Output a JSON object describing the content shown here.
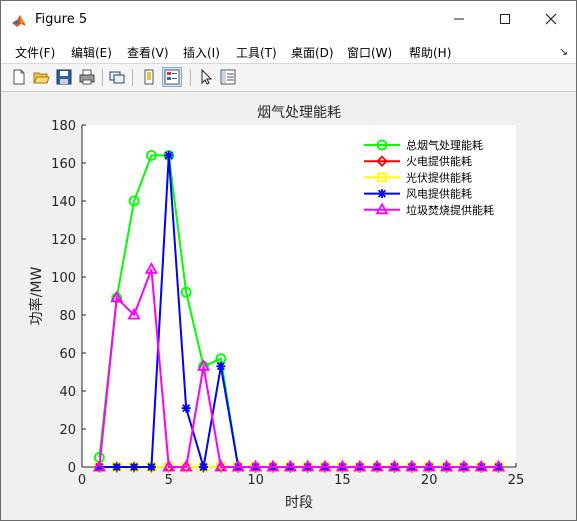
{
  "window": {
    "title": "Figure 5"
  },
  "menu": [
    "文件(F)",
    "编辑(E)",
    "查看(V)",
    "插入(I)",
    "工具(T)",
    "桌面(D)",
    "窗口(W)",
    "帮助(H)"
  ],
  "toolbar_icons": [
    "new-figure-icon",
    "open-file-icon",
    "save-icon",
    "print-icon",
    "link-plot-icon",
    "hide-plot-tools-icon",
    "show-plot-tools-icon",
    "edit-plot-icon",
    "property-inspector-icon"
  ],
  "chart_data": {
    "type": "line",
    "title": "烟气处理能耗",
    "xlabel": "时段",
    "ylabel": "功率/MW",
    "xlim": [
      0,
      25
    ],
    "ylim": [
      0,
      180
    ],
    "xticks": [
      0,
      5,
      10,
      15,
      20,
      25
    ],
    "yticks": [
      0,
      20,
      40,
      60,
      80,
      100,
      120,
      140,
      160,
      180
    ],
    "x": [
      1,
      2,
      3,
      4,
      5,
      6,
      7,
      8,
      9,
      10,
      11,
      12,
      13,
      14,
      15,
      16,
      17,
      18,
      19,
      20,
      21,
      22,
      23,
      24
    ],
    "legend_position": "top-right",
    "series": [
      {
        "name": "总烟气处理能耗",
        "color": "#00ff00",
        "marker": "circle",
        "values": [
          5,
          89,
          140,
          164,
          164,
          92,
          53,
          57,
          0,
          0,
          0,
          0,
          0,
          0,
          0,
          0,
          0,
          0,
          0,
          0,
          0,
          0,
          0,
          0
        ]
      },
      {
        "name": "火电提供能耗",
        "color": "#ff0000",
        "marker": "diamond",
        "values": [
          0,
          0,
          0,
          0,
          0,
          0,
          0,
          0,
          0,
          0,
          0,
          0,
          0,
          0,
          0,
          0,
          0,
          0,
          0,
          0,
          0,
          0,
          0,
          0
        ]
      },
      {
        "name": "光伏提供能耗",
        "color": "#ffff00",
        "marker": "square",
        "values": [
          0,
          0,
          0,
          0,
          0,
          0,
          0,
          0,
          0,
          0,
          0,
          0,
          0,
          0,
          0,
          0,
          0,
          0,
          0,
          0,
          0,
          0,
          0,
          0
        ]
      },
      {
        "name": "风电提供能耗",
        "color": "#0000ff",
        "marker": "star",
        "values": [
          0,
          0,
          0,
          0,
          164,
          31,
          0,
          53,
          0,
          0,
          0,
          0,
          0,
          0,
          0,
          0,
          0,
          0,
          0,
          0,
          0,
          0,
          0,
          0
        ]
      },
      {
        "name": "垃圾焚烧提供能耗",
        "color": "#ff00ff",
        "marker": "triangle",
        "values": [
          0,
          89,
          80,
          104,
          0,
          0,
          53,
          0,
          0,
          0,
          0,
          0,
          0,
          0,
          0,
          0,
          0,
          0,
          0,
          0,
          0,
          0,
          0,
          0
        ]
      }
    ]
  }
}
